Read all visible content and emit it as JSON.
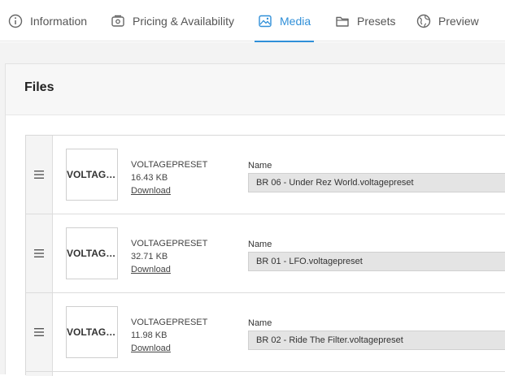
{
  "tabs": [
    {
      "label": "Information",
      "icon": "info-circle-icon",
      "active": false
    },
    {
      "label": "Pricing & Availability",
      "icon": "price-tag-icon",
      "active": false
    },
    {
      "label": "Media",
      "icon": "image-icon",
      "active": true
    },
    {
      "label": "Presets",
      "icon": "folder-icon",
      "active": false
    },
    {
      "label": "Preview",
      "icon": "globe-icon",
      "active": false
    }
  ],
  "panel": {
    "title": "Files",
    "name_label": "Name",
    "download_label": "Download",
    "drag_icon": "drag-handle-icon"
  },
  "files": [
    {
      "thumb_text": "VOLTAGEPRESET",
      "type": "VOLTAGEPRESET",
      "size": "16.43 KB",
      "name": "BR 06 - Under Rez World.voltagepreset"
    },
    {
      "thumb_text": "VOLTAGEPRESET",
      "type": "VOLTAGEPRESET",
      "size": "32.71 KB",
      "name": "BR 01 - LFO.voltagepreset"
    },
    {
      "thumb_text": "VOLTAGEPRESET",
      "type": "VOLTAGEPRESET",
      "size": "11.98 KB",
      "name": "BR 02 - Ride The Filter.voltagepreset"
    }
  ],
  "colors": {
    "accent": "#2f8fd8",
    "page_bg": "#f3f3f3",
    "input_bg": "#e4e4e4"
  }
}
